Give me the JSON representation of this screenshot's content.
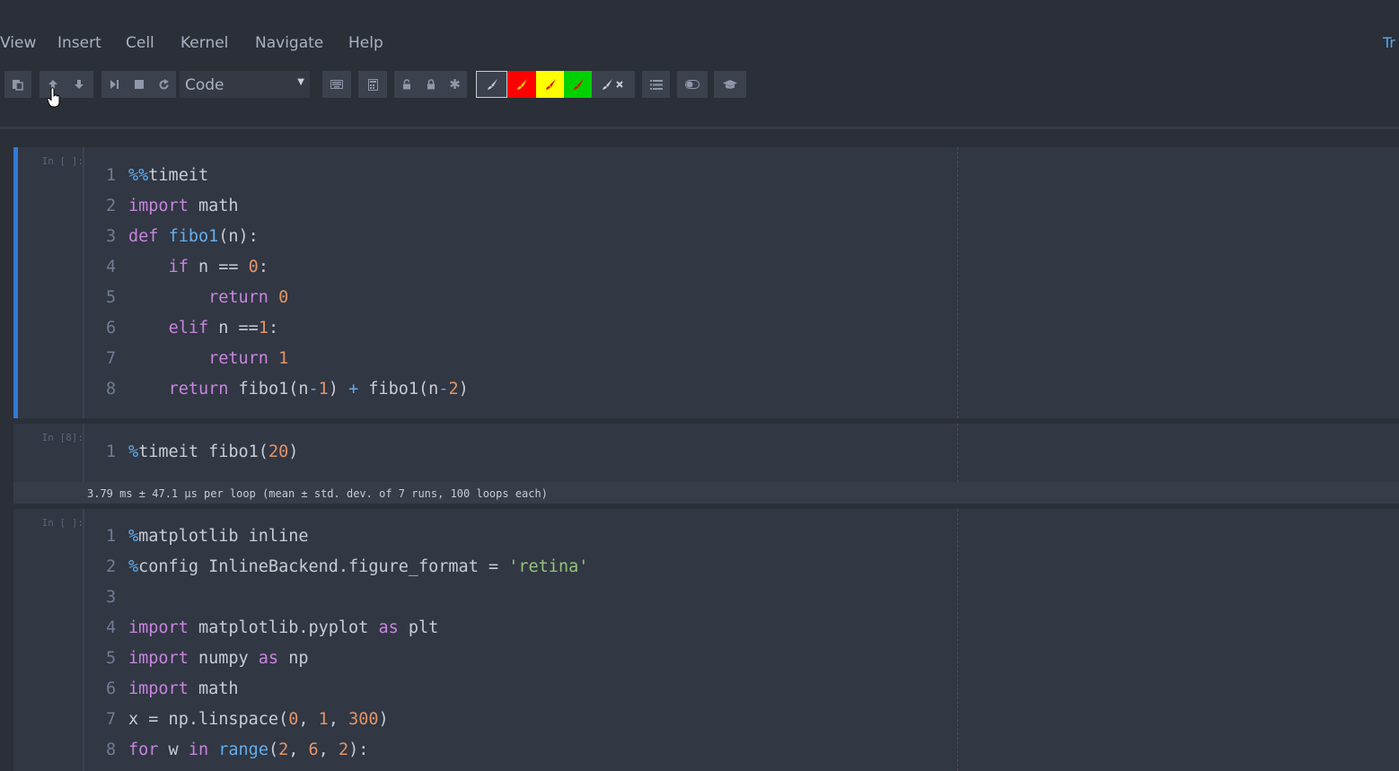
{
  "menubar": {
    "items": [
      "View",
      "Insert",
      "Cell",
      "Kernel",
      "Navigate",
      "Help"
    ],
    "trusted": "Tr"
  },
  "toolbar": {
    "cell_type": "Code",
    "colors": {
      "red": "#ff0000",
      "yellow": "#ffff00",
      "green": "#00e000"
    }
  },
  "cells": [
    {
      "prompt": "In [ ]:",
      "lines": [
        {
          "n": "1",
          "html": "<span class=\"mg\">%%</span>timeit"
        },
        {
          "n": "2",
          "html": "<span class=\"kw\">import</span> math"
        },
        {
          "n": "3",
          "html": "<span class=\"kw\">def</span> <span class=\"fn\">fibo1</span>(n):"
        },
        {
          "n": "4",
          "html": "    <span class=\"kw\">if</span> n == <span class=\"num\">0</span>:"
        },
        {
          "n": "5",
          "html": "        <span class=\"kw\">return</span> <span class=\"num\">0</span>"
        },
        {
          "n": "6",
          "html": "    <span class=\"kw\">elif</span> n ==<span class=\"num\">1</span>:"
        },
        {
          "n": "7",
          "html": "        <span class=\"kw\">return</span> <span class=\"num\">1</span>"
        },
        {
          "n": "8",
          "html": "    <span class=\"kw\">return</span> fibo1(n<span class=\"op\">-</span><span class=\"num\">1</span>) <span class=\"op\">+</span> fibo1(n<span class=\"op\">-</span><span class=\"num\">2</span>)"
        }
      ]
    },
    {
      "prompt": "In [8]:",
      "lines": [
        {
          "n": "1",
          "html": "<span class=\"mg\">%</span>timeit fibo1(<span class=\"num\">20</span>)"
        }
      ],
      "output": "3.79 ms ± 47.1 µs per loop (mean ± std. dev. of 7 runs, 100 loops each)"
    },
    {
      "prompt": "In [ ]:",
      "lines": [
        {
          "n": "1",
          "html": "<span class=\"mg\">%</span>matplotlib inline"
        },
        {
          "n": "2",
          "html": "<span class=\"mg\">%</span>config InlineBackend.figure_format = <span class=\"str\">'retina'</span>"
        },
        {
          "n": "3",
          "html": ""
        },
        {
          "n": "4",
          "html": "<span class=\"kw\">import</span> matplotlib.pyplot <span class=\"kw\">as</span> plt"
        },
        {
          "n": "5",
          "html": "<span class=\"kw\">import</span> numpy <span class=\"kw\">as</span> np"
        },
        {
          "n": "6",
          "html": "<span class=\"kw\">import</span> math"
        },
        {
          "n": "7",
          "html": "x = np.linspace(<span class=\"num\">0</span>, <span class=\"num\">1</span>, <span class=\"num\">300</span>)"
        },
        {
          "n": "8",
          "html": "<span class=\"kw\">for</span> w <span class=\"kw\">in</span> <span class=\"fn\">range</span>(<span class=\"num\">2</span>, <span class=\"num\">6</span>, <span class=\"num\">2</span>):"
        }
      ]
    }
  ]
}
